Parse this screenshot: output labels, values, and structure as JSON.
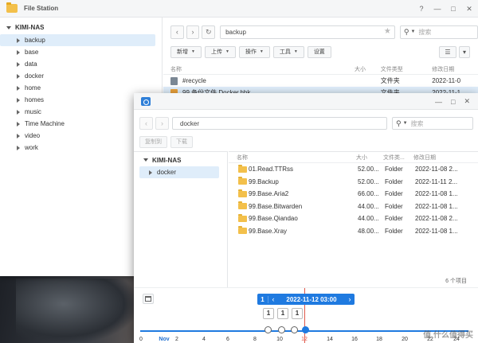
{
  "file_station": {
    "title": "File Station",
    "controls": {
      "help": "?",
      "minimize": "—",
      "maximize": "□",
      "close": "✕"
    },
    "tree": {
      "root": "KIMI-NAS",
      "items": [
        "backup",
        "base",
        "data",
        "docker",
        "home",
        "homes",
        "music",
        "Time Machine",
        "video",
        "work"
      ]
    },
    "path": "backup",
    "search_placeholder": "搜索",
    "toolbar": {
      "new": "新增",
      "upload": "上传",
      "action": "操作",
      "tools": "工具",
      "settings": "设置"
    },
    "columns": {
      "name": "名称",
      "size": "大小",
      "type": "文件类型",
      "date": "修改日期"
    },
    "rows": [
      {
        "name": "#recycle",
        "size": "",
        "type": "文件夹",
        "date": "2022-11-0"
      },
      {
        "name": "99.备份文件.Docker.hbk",
        "size": "",
        "type": "文件夹",
        "date": "2022-11-1"
      }
    ]
  },
  "restore_window": {
    "controls": {
      "minimize": "—",
      "maximize": "□",
      "close": "✕"
    },
    "path": "docker",
    "search_placeholder": "搜索",
    "toolbar": {
      "copy_to": "复制到",
      "download": "下载"
    },
    "tree": {
      "root": "KIMI-NAS",
      "items": [
        "docker"
      ]
    },
    "columns": {
      "name": "名称",
      "size": "大小",
      "type": "文件类...",
      "date": "修改日期"
    },
    "rows": [
      {
        "name": "01.Read.TTRss",
        "size": "52.00...",
        "type": "Folder",
        "date": "2022-11-08 2..."
      },
      {
        "name": "99.Backup",
        "size": "52.00...",
        "type": "Folder",
        "date": "2022-11-11 2..."
      },
      {
        "name": "99.Base.Aria2",
        "size": "66.00...",
        "type": "Folder",
        "date": "2022-11-08 1..."
      },
      {
        "name": "99.Base.Bitwarden",
        "size": "44.00...",
        "type": "Folder",
        "date": "2022-11-08 1..."
      },
      {
        "name": "99.Base.Qiandao",
        "size": "44.00...",
        "type": "Folder",
        "date": "2022-11-08 2..."
      },
      {
        "name": "99.Base.Xray",
        "size": "48.00...",
        "type": "Folder",
        "date": "2022-11-08 1..."
      }
    ],
    "item_count": "6 个项目",
    "timeline": {
      "version_index": "1",
      "current_date": "2022-11-12 03:00",
      "counts": [
        "1",
        "1",
        "1"
      ],
      "month_label": "Nov",
      "ticks": [
        "0",
        "2",
        "4",
        "6",
        "8",
        "10",
        "12",
        "14",
        "16",
        "18",
        "20",
        "22",
        "24"
      ],
      "current_tick": "12",
      "accent": "#1f7ae0"
    }
  },
  "watermark": "值 什么值得买"
}
